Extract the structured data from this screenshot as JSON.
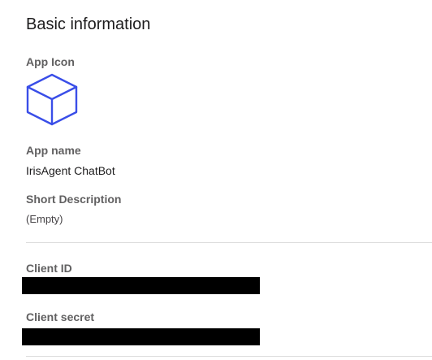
{
  "section": {
    "title": "Basic information"
  },
  "app_icon": {
    "label": "App Icon",
    "icon": "cube-icon",
    "color": "#3a4ee8"
  },
  "app_name": {
    "label": "App name",
    "value": "IrisAgent ChatBot"
  },
  "short_description": {
    "label": "Short Description",
    "value": "(Empty)"
  },
  "client_id": {
    "label": "Client ID",
    "value_hidden": true
  },
  "client_secret": {
    "label": "Client secret",
    "value_hidden": true
  },
  "colors": {
    "label_gray": "#616061",
    "text_dark": "#1d1c1d",
    "divider": "#dddddd",
    "redaction": "#000000"
  }
}
